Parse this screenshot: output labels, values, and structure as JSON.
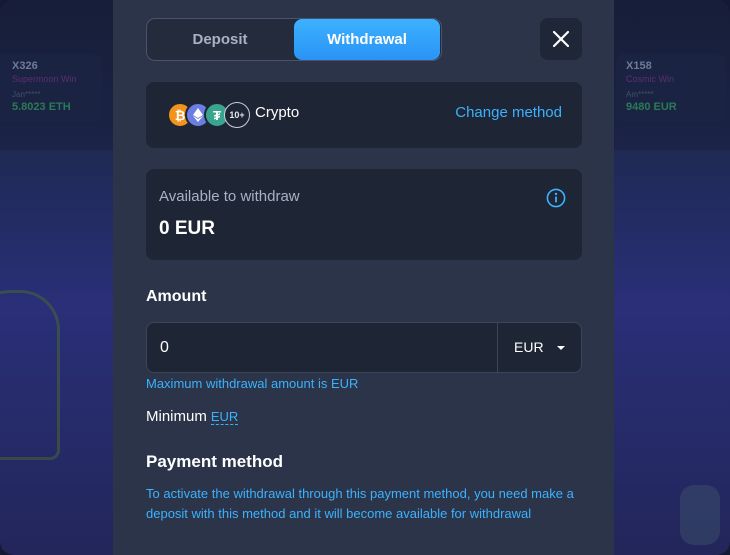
{
  "background": {
    "cards": [
      {
        "id": "X326",
        "title": "Supermoon Win",
        "user": "Jan*****",
        "amount": "5.8023 ETH"
      },
      {
        "id": "X158",
        "title": "Cosmic Win",
        "user": "Am*****",
        "amount": "9480 EUR"
      }
    ]
  },
  "tabs": {
    "deposit": "Deposit",
    "withdrawal": "Withdrawal",
    "active": "withdrawal"
  },
  "method": {
    "icons": [
      "bitcoin-icon",
      "ethereum-icon",
      "tether-icon"
    ],
    "more_badge": "10+",
    "name": "Crypto",
    "change_label": "Change method"
  },
  "balance": {
    "label": "Available to withdraw",
    "value": "0 EUR"
  },
  "amount": {
    "label": "Amount",
    "value": "0",
    "currency": "EUR",
    "max_note": "Maximum withdrawal amount is EUR",
    "minimum_label": "Minimum",
    "minimum_value": "EUR"
  },
  "payment": {
    "title": "Payment method",
    "note": "To activate the withdrawal through this payment method, you need make a deposit with this method and it will become available for withdrawal"
  },
  "colors": {
    "accent": "#3cb2ff",
    "panel": "#2b3448",
    "box": "#1e2535"
  }
}
